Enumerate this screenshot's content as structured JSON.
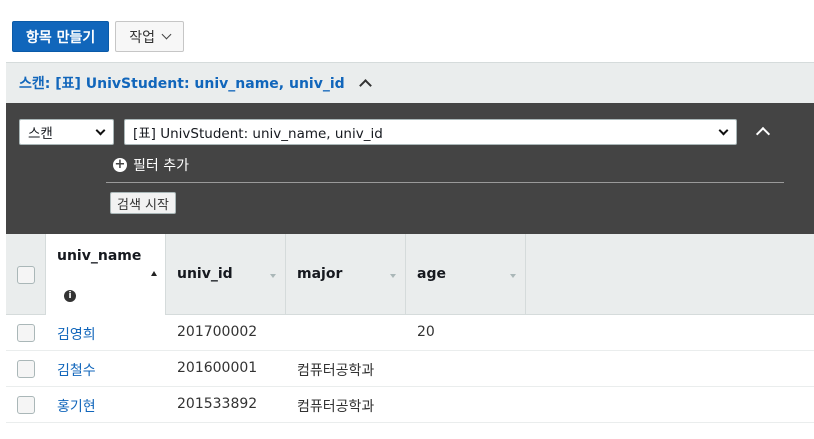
{
  "toolbar": {
    "create_item": "항목 만들기",
    "actions": "작업"
  },
  "scan_header": {
    "title": "스캔: [표] UnivStudent: univ_name, univ_id"
  },
  "query_panel": {
    "operation": "스캔",
    "target": "[표] UnivStudent: univ_name, univ_id",
    "add_filter": "필터 추가",
    "start_search": "검색 시작"
  },
  "table": {
    "columns": [
      "univ_name",
      "univ_id",
      "major",
      "age"
    ],
    "sorted_column": "univ_name",
    "sort_direction": "ascending",
    "rows": [
      {
        "univ_name": "김영희",
        "univ_id": "201700002",
        "major": "",
        "age": "20"
      },
      {
        "univ_name": "김철수",
        "univ_id": "201600001",
        "major": "컴퓨터공학과",
        "age": ""
      },
      {
        "univ_name": "홍기현",
        "univ_id": "201533892",
        "major": "컴퓨터공학과",
        "age": ""
      }
    ]
  },
  "colors": {
    "primary": "#1166bb",
    "panel_dark": "#444444",
    "header_bg": "#eaeded"
  }
}
